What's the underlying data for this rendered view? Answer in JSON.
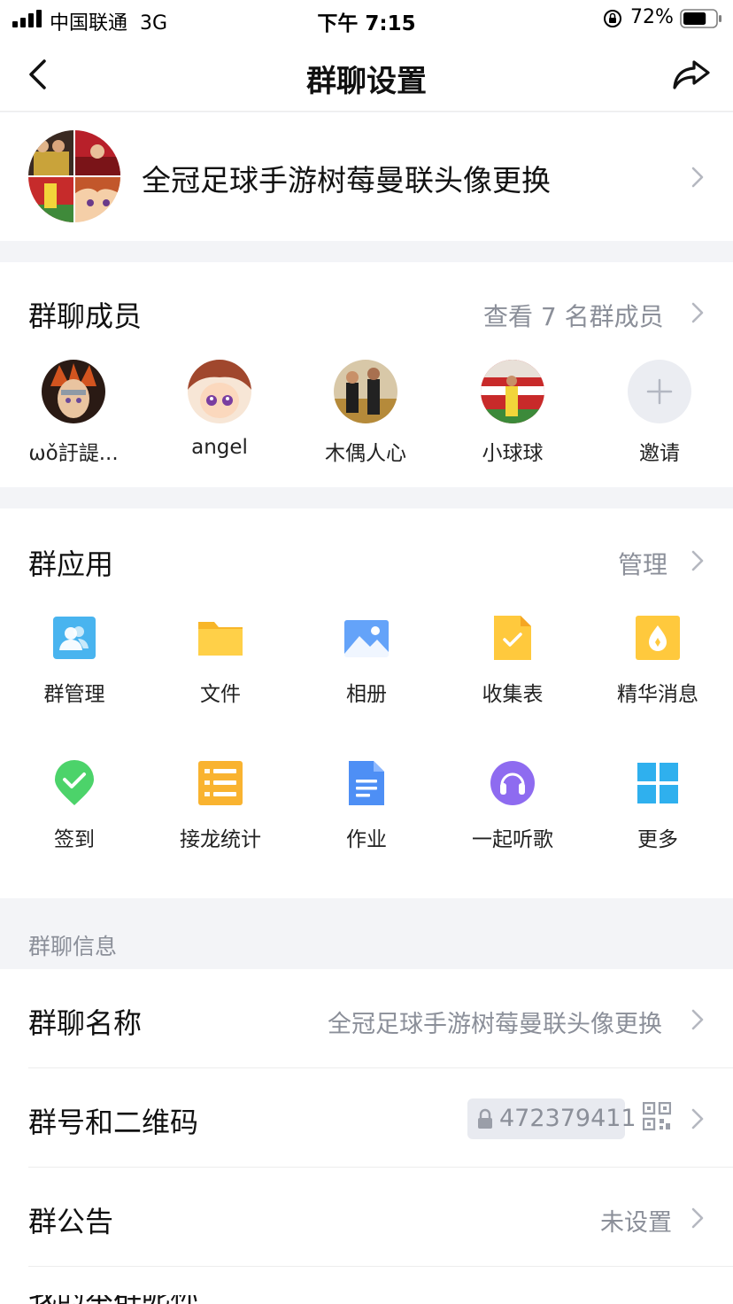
{
  "status_bar": {
    "carrier": "中国联通",
    "network": "3G",
    "time": "下午 7:15",
    "battery": "72%",
    "battery_level": 0.72
  },
  "nav": {
    "title": "群聊设置"
  },
  "group": {
    "name": "全冠足球手游树莓曼联头像更换"
  },
  "members": {
    "title": "群聊成员",
    "view_all": "查看 7 名群成员",
    "list": [
      {
        "name": "ωǒ訏諟...",
        "avatar": "avatar-ninja"
      },
      {
        "name": "angel",
        "avatar": "avatar-anime-girl"
      },
      {
        "name": "木偶人心",
        "avatar": "avatar-team"
      },
      {
        "name": "小球球",
        "avatar": "avatar-goalkeeper"
      }
    ],
    "invite": "邀请"
  },
  "apps": {
    "title": "群应用",
    "manage": "管理",
    "items": [
      {
        "label": "群管理",
        "icon": "group-manage-icon"
      },
      {
        "label": "文件",
        "icon": "folder-icon"
      },
      {
        "label": "相册",
        "icon": "album-icon"
      },
      {
        "label": "收集表",
        "icon": "collection-form-icon"
      },
      {
        "label": "精华消息",
        "icon": "essence-icon"
      },
      {
        "label": "签到",
        "icon": "check-in-icon"
      },
      {
        "label": "接龙统计",
        "icon": "relay-stats-icon"
      },
      {
        "label": "作业",
        "icon": "homework-icon"
      },
      {
        "label": "一起听歌",
        "icon": "listen-together-icon"
      },
      {
        "label": "更多",
        "icon": "more-grid-icon"
      }
    ]
  },
  "info": {
    "section_label": "群聊信息",
    "name_row": {
      "label": "群聊名称",
      "value": "全冠足球手游树莓曼联头像更换"
    },
    "id_row": {
      "label": "群号和二维码",
      "value": "472379411"
    },
    "notice_row": {
      "label": "群公告",
      "value": "未设置"
    },
    "next_row": {
      "label": "我的本群昵称"
    }
  },
  "colors": {
    "background": "#f3f4f7",
    "secondary_text": "#8b8f99",
    "app_blue": "#4ea7f7",
    "app_yellow": "#ffc93d",
    "check_in_green": "#4cd36a",
    "listen_purple": "#8e6bf0"
  }
}
